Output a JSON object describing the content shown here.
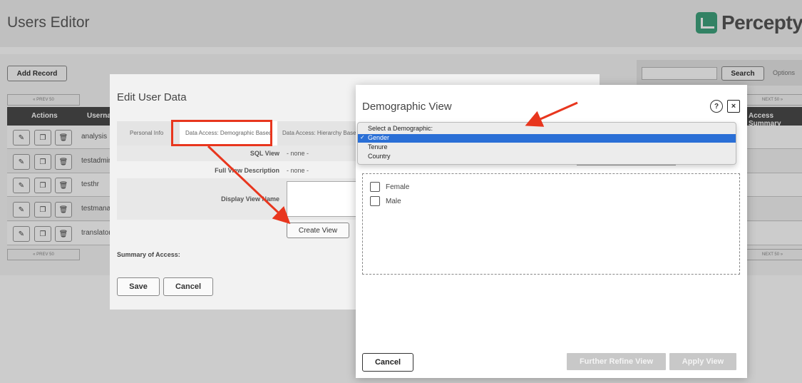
{
  "page": {
    "title": "Users Editor",
    "logo_text": "Perceptyx",
    "add_record_label": "Add Record",
    "search_label": "Search",
    "options_label": "Options",
    "pager_prev": "« PREV 50",
    "pager_next": "NEXT 50 »",
    "table_headers": {
      "actions": "Actions",
      "username": "Userna",
      "access_summary": "Access Summary"
    },
    "rows": [
      "analysis",
      "testadmin",
      "testhr",
      "testmanag",
      "translator"
    ]
  },
  "edit_dialog": {
    "title": "Edit User Data",
    "tabs": [
      "Personal Info",
      "Data Access: Demographic Based",
      "Data Access: Hierarchy Base"
    ],
    "sql_view_label": "SQL View",
    "sql_view_value": "- none -",
    "full_view_label": "Full View Description",
    "full_view_value": "- none -",
    "display_name_label": "Display View Name",
    "create_view_label": "Create View",
    "summary_label": "Summary of Access:",
    "save_label": "Save",
    "cancel_label": "Cancel"
  },
  "demographic_modal": {
    "title": "Demographic View",
    "help_glyph": "?",
    "close_glyph": "×",
    "select_prompt": "Select a Demographic:",
    "select_options": [
      "Gender",
      "Tenure",
      "Country"
    ],
    "selected_option": "Gender",
    "checkbox_options": [
      "Female",
      "Male"
    ],
    "cancel_label": "Cancel",
    "further_refine_label": "Further Refine View",
    "apply_label": "Apply View"
  },
  "colors": {
    "accent_green": "#2e9e7a",
    "highlight_red": "#e8361e",
    "selection_blue": "#2a6fd6"
  }
}
